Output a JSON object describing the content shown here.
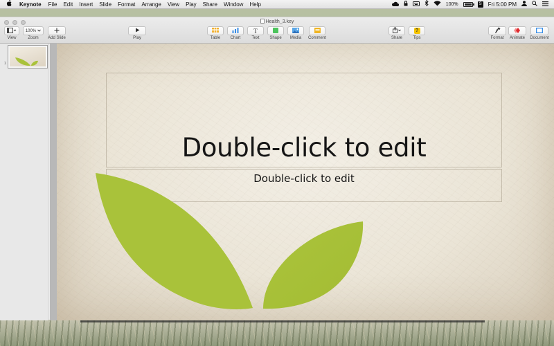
{
  "menubar": {
    "app_name": "Keynote",
    "items": [
      "File",
      "Edit",
      "Insert",
      "Slide",
      "Format",
      "Arrange",
      "View",
      "Play",
      "Share",
      "Window",
      "Help"
    ],
    "battery_percent": "100%",
    "clock": "Fri 5:00 PM",
    "badge_text": "S"
  },
  "window": {
    "document_title": "Health_3.key"
  },
  "toolbar": {
    "view_label": "View",
    "zoom_value": "100%",
    "zoom_label": "Zoom",
    "add_slide_label": "Add Slide",
    "play_label": "Play",
    "table_label": "Table",
    "chart_label": "Chart",
    "text_label": "Text",
    "text_icon_glyph": "T",
    "shape_label": "Shape",
    "media_label": "Media",
    "comment_label": "Comment",
    "share_label": "Share",
    "tips_label": "Tips",
    "tips_glyph": "?",
    "format_label": "Format",
    "animate_label": "Animate",
    "document_label": "Document"
  },
  "sidebar": {
    "slides": [
      {
        "number": "1"
      }
    ]
  },
  "slide": {
    "title": "Double-click to edit",
    "subtitle": "Double-click to edit",
    "leaf_color": "#a9c23a"
  },
  "icons": {
    "apple": "apple-icon",
    "spotlight": "search-icon",
    "user": "user-icon"
  }
}
